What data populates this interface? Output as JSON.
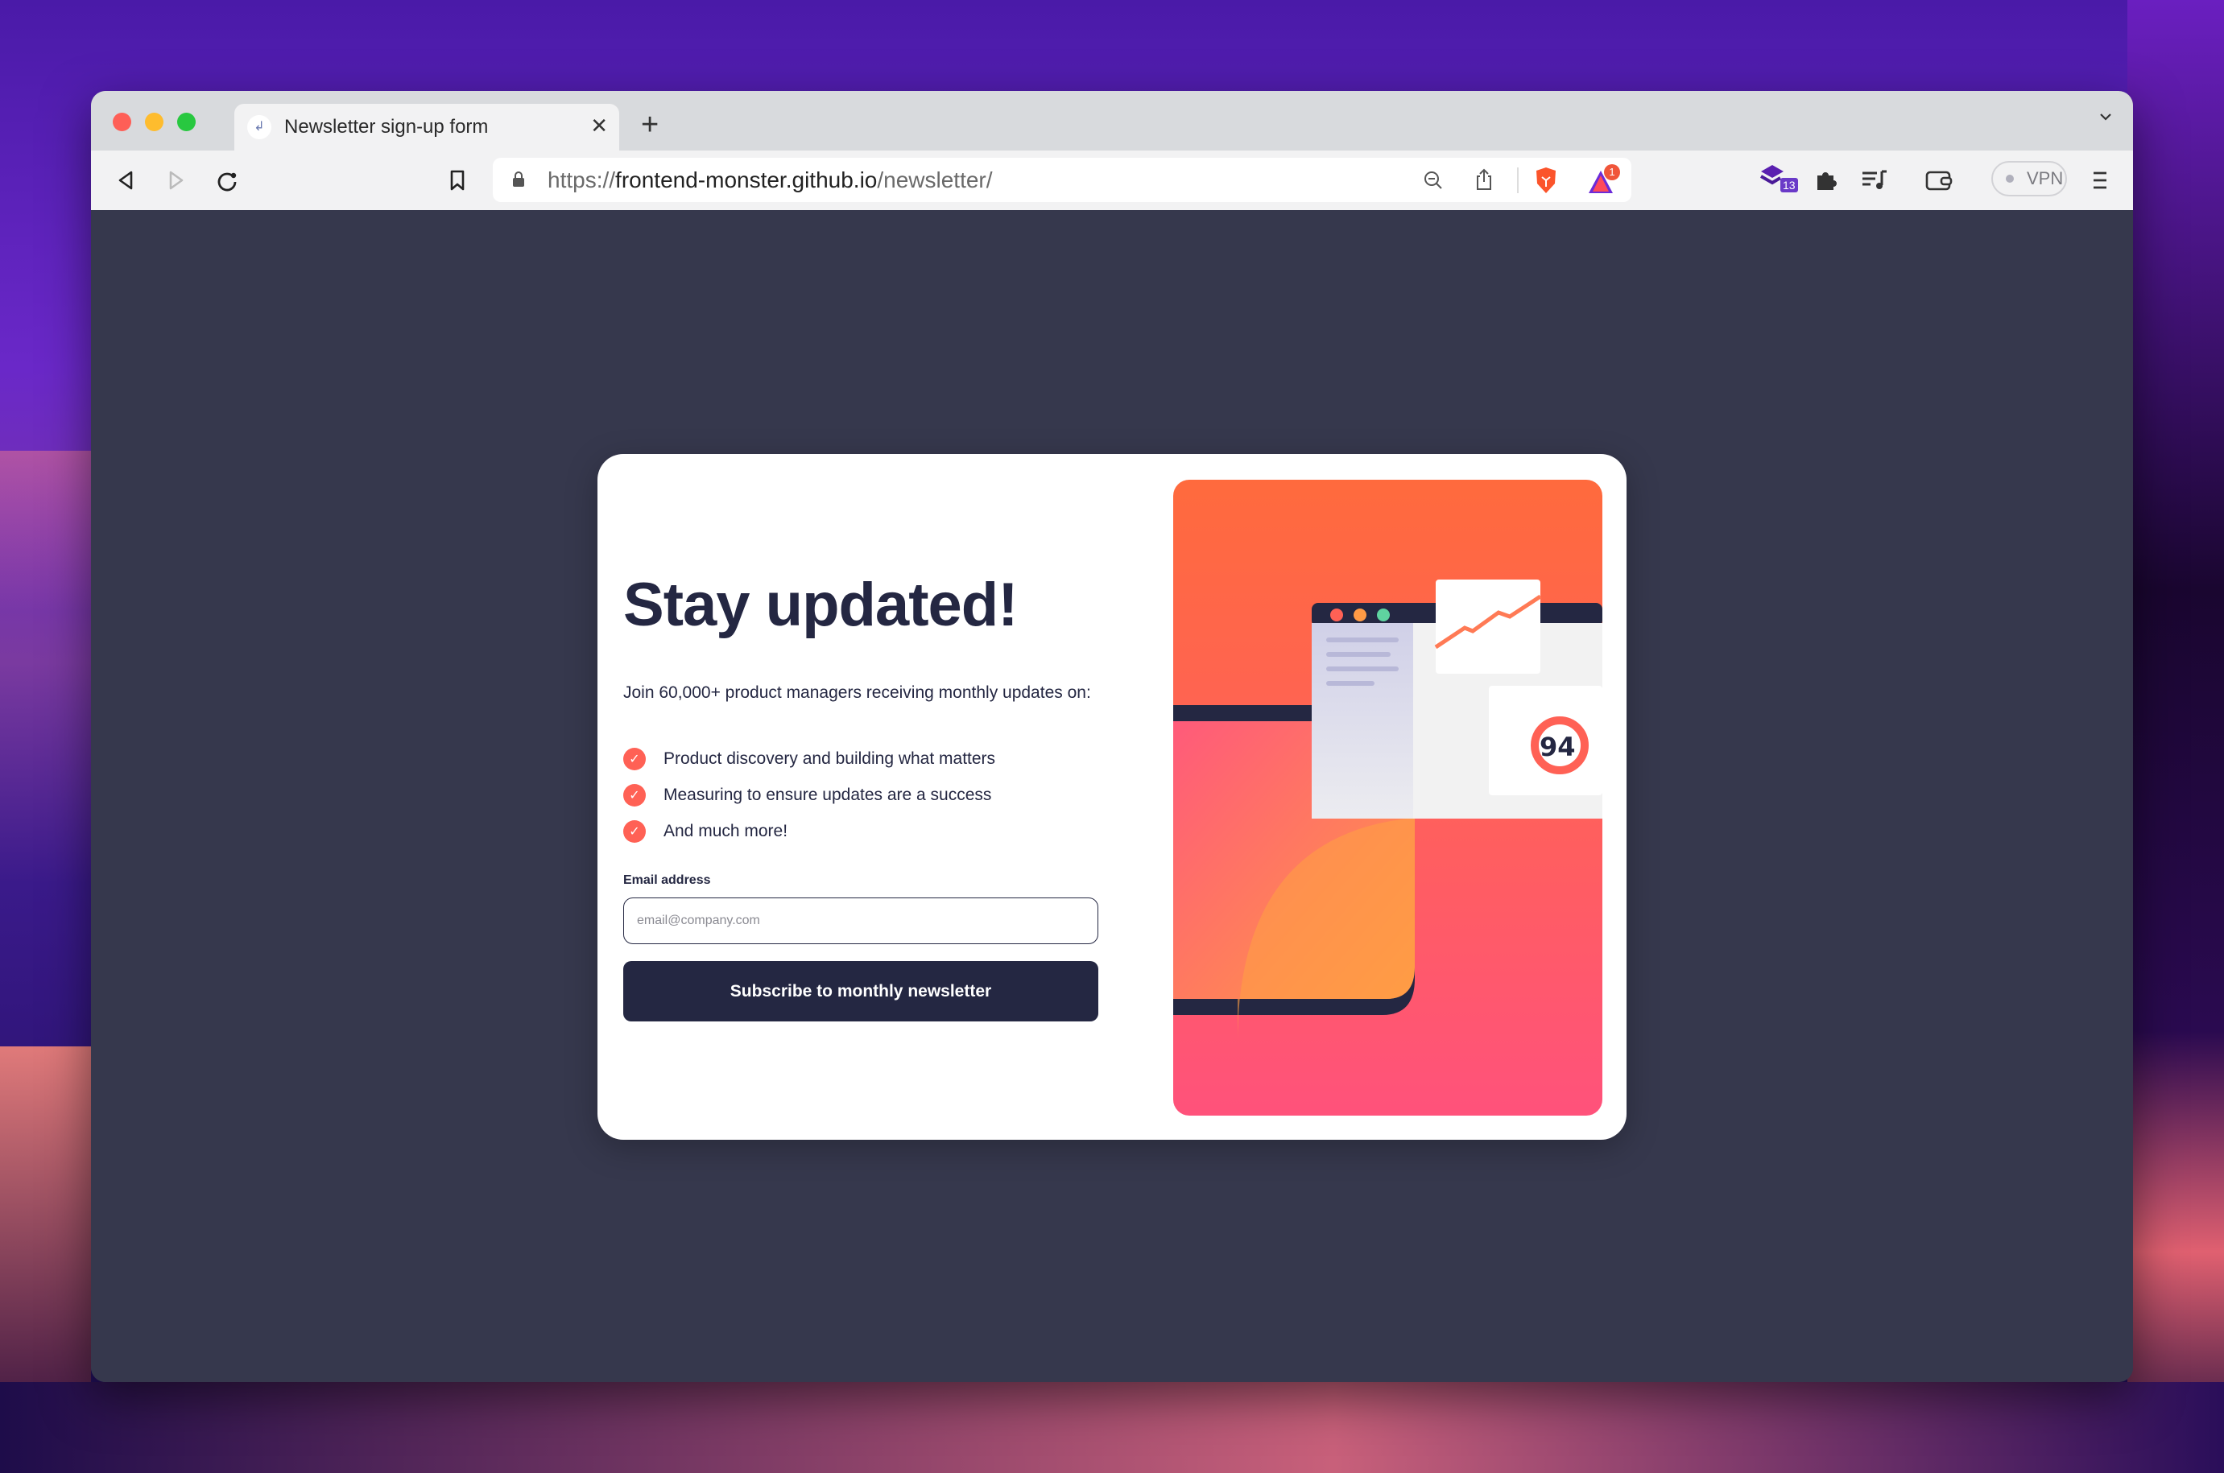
{
  "browser": {
    "tab": {
      "title": "Newsletter sign-up form",
      "favicon": "frontend-monster-favicon"
    },
    "url": {
      "scheme": "https://",
      "host": "frontend-monster.github.io",
      "path": "/newsletter/"
    },
    "extension_badge_count": "13",
    "brave_rewards_badge": "1",
    "vpn_label": "VPN",
    "icons": [
      "back-icon",
      "forward-icon",
      "reload-icon",
      "bookmark-icon",
      "lock-icon",
      "zoom-out-icon",
      "share-icon",
      "brave-shields-icon",
      "brave-rewards-icon",
      "extension-icon",
      "puzzle-icon",
      "playlist-icon",
      "wallet-icon",
      "menu-icon",
      "chevron-down-icon",
      "close-icon",
      "plus-icon"
    ]
  },
  "page": {
    "heading": "Stay updated!",
    "intro": "Join 60,000+ product managers receiving monthly updates on:",
    "benefits": [
      "Product discovery and building what matters",
      "Measuring to ensure updates are a success",
      "And much more!"
    ],
    "email": {
      "label": "Email address",
      "placeholder": "email@company.com",
      "value": ""
    },
    "subscribe_label": "Subscribe to monthly newsletter",
    "illustration": {
      "score": "94"
    },
    "colors": {
      "primary": "#242742",
      "accent": "#ff6155",
      "background": "#36384d"
    }
  }
}
